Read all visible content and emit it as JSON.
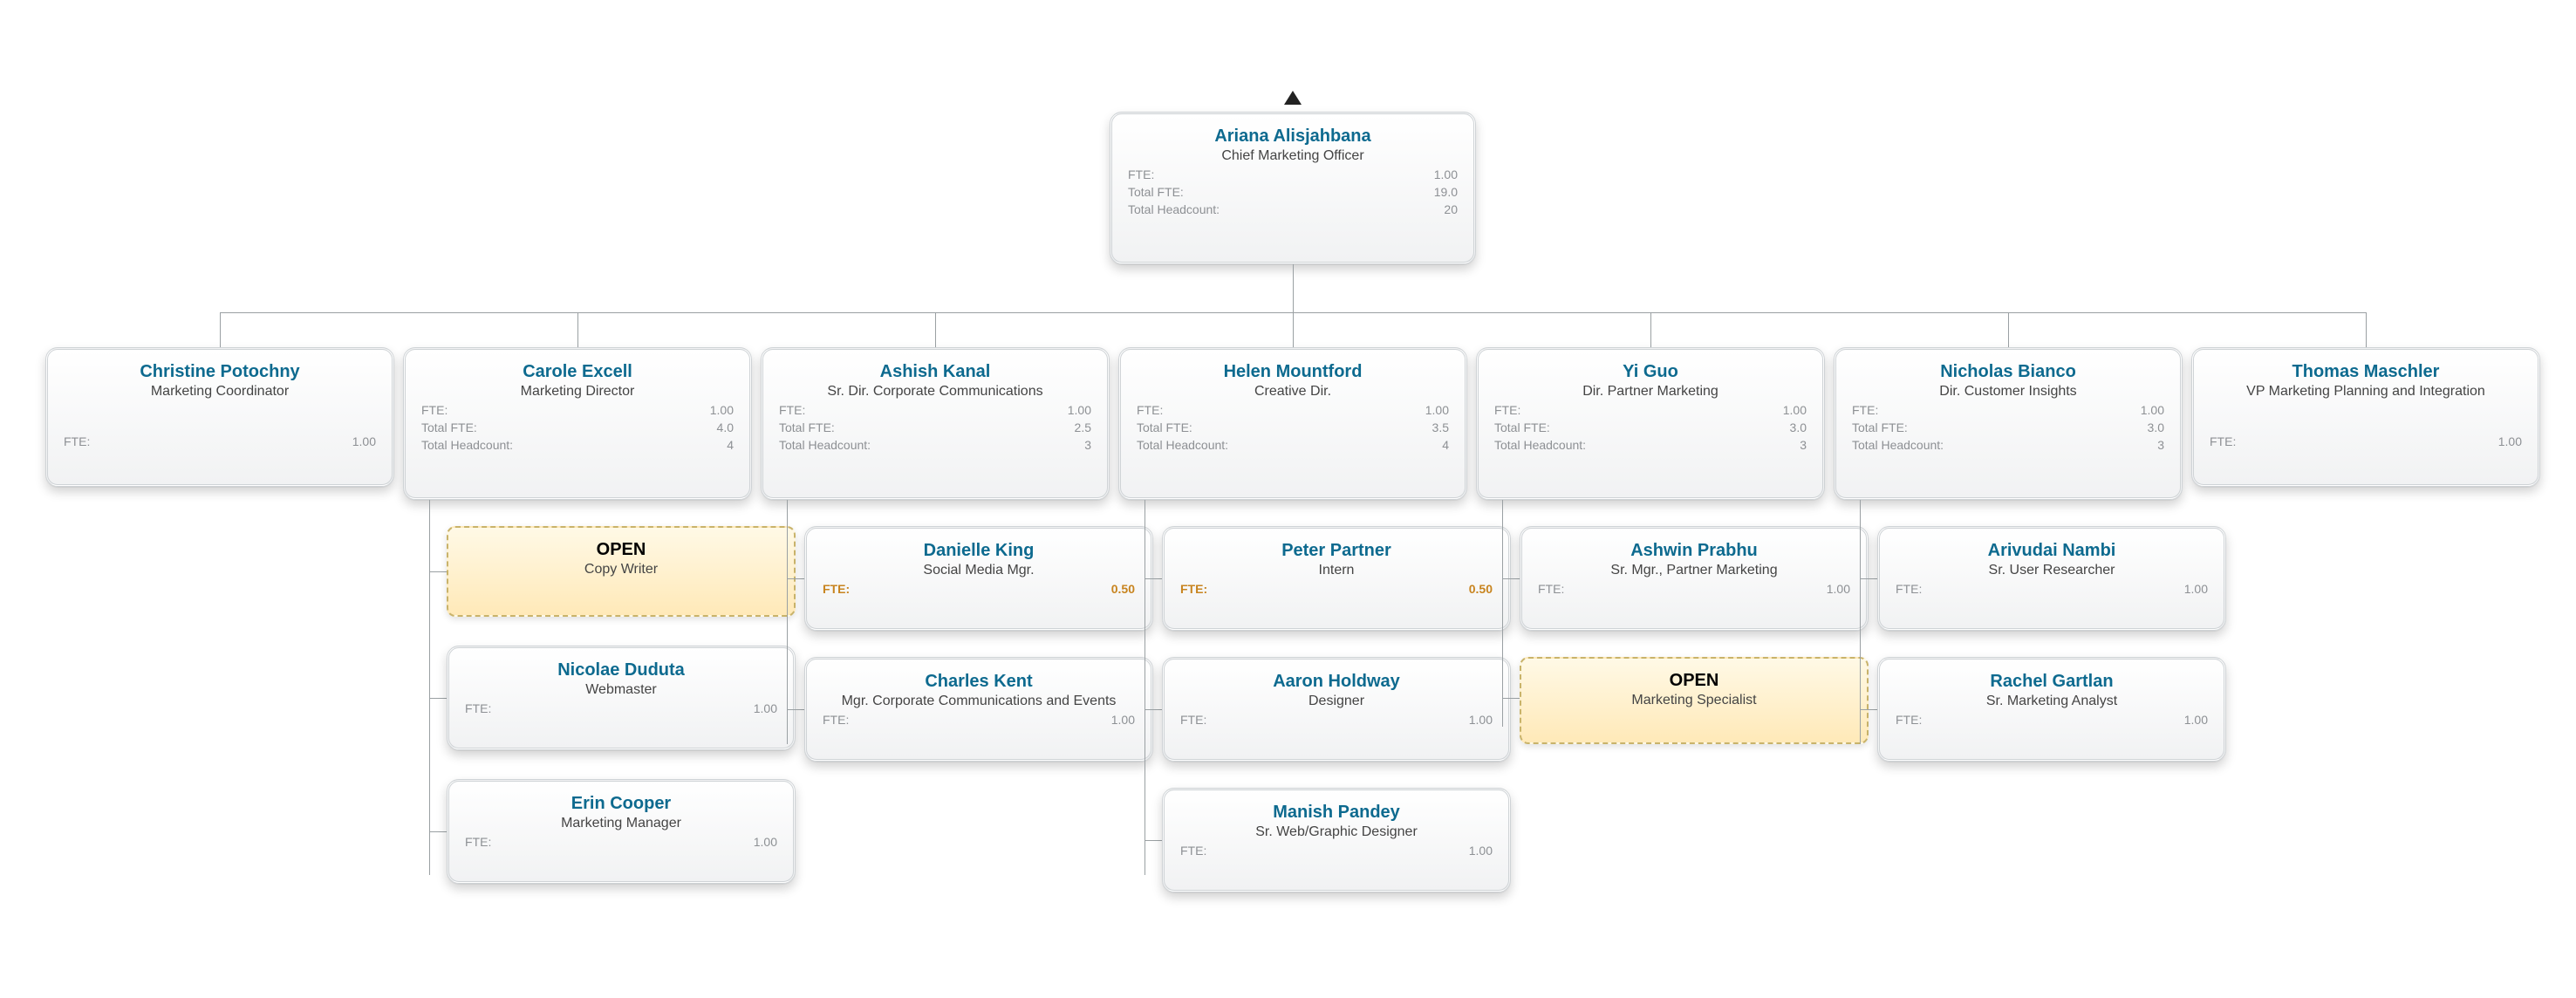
{
  "labels": {
    "fte": "FTE:",
    "totalFte": "Total FTE:",
    "totalHeadcount": "Total Headcount:"
  },
  "root": {
    "name": "Ariana Alisjahbana",
    "title": "Chief Marketing Officer",
    "fte": "1.00",
    "totalFte": "19.0",
    "totalHeadcount": "20"
  },
  "level2": [
    {
      "id": "christine",
      "name": "Christine Potochny",
      "title": "Marketing Coordinator",
      "fte": "1.00"
    },
    {
      "id": "carole",
      "name": "Carole Excell",
      "title": "Marketing Director",
      "fte": "1.00",
      "totalFte": "4.0",
      "totalHeadcount": "4"
    },
    {
      "id": "ashish",
      "name": "Ashish Kanal",
      "title": "Sr. Dir. Corporate Communications",
      "fte": "1.00",
      "totalFte": "2.5",
      "totalHeadcount": "3"
    },
    {
      "id": "helen",
      "name": "Helen Mountford",
      "title": "Creative Dir.",
      "fte": "1.00",
      "totalFte": "3.5",
      "totalHeadcount": "4"
    },
    {
      "id": "yi",
      "name": "Yi Guo",
      "title": "Dir. Partner Marketing",
      "fte": "1.00",
      "totalFte": "3.0",
      "totalHeadcount": "3"
    },
    {
      "id": "nicholas",
      "name": "Nicholas Bianco",
      "title": "Dir. Customer Insights",
      "fte": "1.00",
      "totalFte": "3.0",
      "totalHeadcount": "3"
    },
    {
      "id": "thomas",
      "name": "Thomas Maschler",
      "title": "VP Marketing Planning and Integration",
      "fte": "1.00"
    }
  ],
  "children": {
    "carole": [
      {
        "open": true,
        "name": "OPEN",
        "title": "Copy Writer"
      },
      {
        "name": "Nicolae Duduta",
        "title": "Webmaster",
        "fte": "1.00"
      },
      {
        "name": "Erin Cooper",
        "title": "Marketing Manager",
        "fte": "1.00"
      }
    ],
    "ashish": [
      {
        "name": "Danielle King",
        "title": "Social Media Mgr.",
        "fte": "0.50",
        "highlightFte": true
      },
      {
        "name": "Charles Kent",
        "title": "Mgr. Corporate Communications and Events",
        "fte": "1.00"
      }
    ],
    "helen": [
      {
        "name": "Peter Partner",
        "title": "Intern",
        "fte": "0.50",
        "highlightFte": true
      },
      {
        "name": "Aaron Holdway",
        "title": "Designer",
        "fte": "1.00"
      },
      {
        "name": "Manish Pandey",
        "title": "Sr. Web/Graphic Designer",
        "fte": "1.00"
      }
    ],
    "yi": [
      {
        "name": "Ashwin Prabhu",
        "title": "Sr. Mgr., Partner Marketing",
        "fte": "1.00"
      },
      {
        "open": true,
        "name": "OPEN",
        "title": "Marketing Specialist"
      }
    ],
    "nicholas": [
      {
        "name": "Arivudai Nambi",
        "title": "Sr. User Researcher",
        "fte": "1.00"
      },
      {
        "name": "Rachel Gartlan",
        "title": "Sr. Marketing Analyst",
        "fte": "1.00"
      }
    ]
  }
}
